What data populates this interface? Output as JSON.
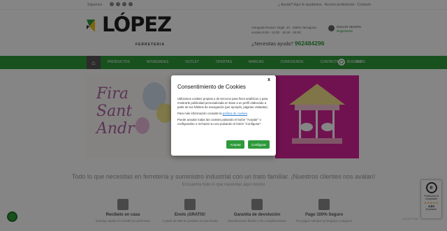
{
  "topbar": {
    "follow": "Síguenos",
    "links": "¿ Ayuda? Aquí te ayudamos · Acceso profesional · Contacto"
  },
  "header": {
    "logo_name": "LÓPEZ",
    "logo_sub": "FERRETERIA",
    "contact": "Avinguda Rovira i Virgili, 10 · 43001 Tarragona · Horario 9:00 - 13:30 · 16:30 - 20:00",
    "phone_question": "¿Necesitas ayuda?",
    "phone": "962484296",
    "login_line1": "INICIAR SESIÓN",
    "login_line2": "Registrarse"
  },
  "nav": {
    "items": [
      "PRODUCTOS",
      "NOVEDADES",
      "OUTLET",
      "OFERTAS",
      "MARCAS",
      "CONOCENOS",
      "CONTACTA",
      "BLOG"
    ],
    "search_label": "BUSCAR"
  },
  "banner": {
    "headline_lines": [
      "Fira",
      "Sant",
      "Andr"
    ]
  },
  "tagline": "Todo lo que necesitas en ferretería y suministro industrial con un trato familiar. ¡Nuestros clientes nos avalan!",
  "tagline_sub": "Encuentra todo lo que necesitas aquí mismo",
  "features": [
    {
      "title": "Recíbelo en casa",
      "desc": "Entrega rápida en 24/48h en península",
      "icon": "home-icon"
    },
    {
      "title": "Envío ¡GRATIS!",
      "desc": "A partir de 99€ en pedidos en península",
      "icon": "box-icon"
    },
    {
      "title": "Garantía de devolución",
      "desc": "Devoluciones fáciles y sin complicaciones",
      "icon": "refresh-icon"
    },
    {
      "title": "Pago 100% Seguro",
      "desc": "Tus pagos siempre protegidos y seguros",
      "icon": "shield-icon"
    }
  ],
  "trust_badge": {
    "seal": "e",
    "line1": "Protección al",
    "line2": "Comprador",
    "stars": "★★★★★",
    "score": "4,84",
    "label": "Excelente"
  },
  "recaptcha": "reCAPTCHA",
  "modal": {
    "close": "x",
    "title": "Consentimiento de Cookies",
    "p1": "Utilizamos cookies propias y de terceros para fines analíticos y para mostrarte publicidad personalizada en base a un perfil elaborado a partir de tus hábitos de navegación (por ejemplo, páginas visitadas).",
    "p2_prefix": "Para más información consulte la ",
    "p2_link": "política de cookies",
    "p2_suffix": ".",
    "p3": "Puede aceptar todas las cookies pulsando el botón \"Aceptar\" o configurarlas o rechazar su uso pulsando el botón \"Configurar\".",
    "accept": "Aceptar",
    "configure": "Configurar"
  },
  "colors": {
    "brand_green": "#2e9a3b",
    "overlay": "rgba(0,0,0,0.48)",
    "banner_pink": "#d9239a"
  }
}
